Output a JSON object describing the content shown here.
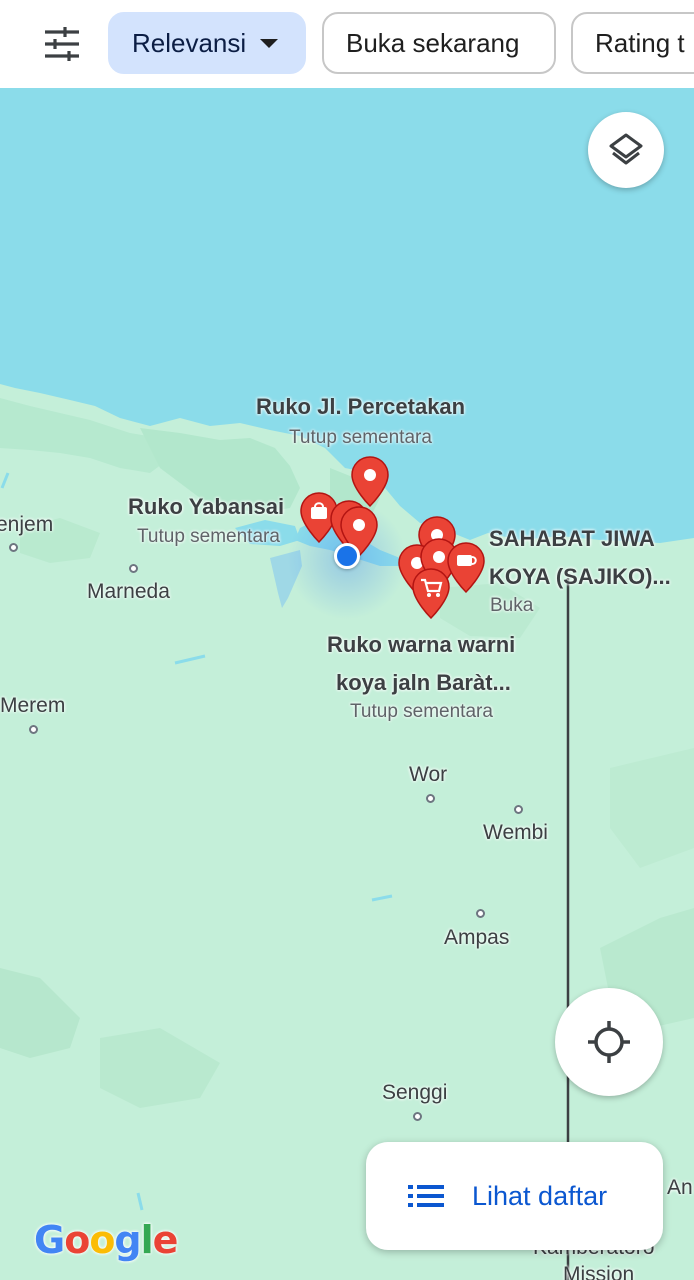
{
  "toolbar": {
    "filter_icon": "tune-icon",
    "chips": [
      {
        "label": "Relevansi",
        "active": true,
        "has_dropdown": true
      },
      {
        "label": "Buka sekarang",
        "active": false
      },
      {
        "label": "Rating t",
        "active": false
      }
    ]
  },
  "map": {
    "colors": {
      "water": "#8bdcea",
      "land": "#c4efd9",
      "pin": "#ea4335",
      "location": "#1a73e8"
    },
    "places": [
      {
        "name": "enjem"
      },
      {
        "name": "Marneda"
      },
      {
        "name": "Merem"
      },
      {
        "name": "Wor"
      },
      {
        "name": "Wembi"
      },
      {
        "name": "Ampas"
      },
      {
        "name": "Senggi"
      },
      {
        "name": "An"
      },
      {
        "name": "Kamberatoro"
      },
      {
        "name": "Mission"
      }
    ],
    "pois": [
      {
        "title": "Ruko Jl. Percetakan",
        "status": "Tutup sementara"
      },
      {
        "title": "Ruko Yabansai",
        "status": "Tutup sementara",
        "icon": "shopping-bag-icon"
      },
      {
        "title_line1": "SAHABAT JIWA",
        "title_line2": "KOYA (SAJIKO)...",
        "status": "Buka",
        "icon": "coffee-cup-icon"
      },
      {
        "title_line1": "Ruko warna warni",
        "title_line2": "koya jaln Baràt...",
        "status": "Tutup sementara",
        "icon": "shopping-cart-icon"
      }
    ]
  },
  "controls": {
    "layers_icon": "layers-icon",
    "locate_icon": "my-location-icon",
    "list_button": {
      "icon": "list-icon",
      "label": "Lihat daftar"
    }
  },
  "branding": {
    "logo_letters": [
      "G",
      "o",
      "o",
      "g",
      "l",
      "e"
    ]
  }
}
